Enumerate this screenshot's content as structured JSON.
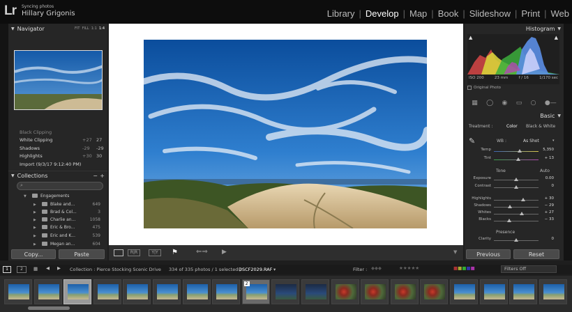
{
  "header": {
    "logo": "Lr",
    "sync_status": "Syncing photos",
    "user_name": "Hillary Grigonis",
    "modules": [
      "Library",
      "Develop",
      "Map",
      "Book",
      "Slideshow",
      "Print",
      "Web"
    ],
    "active_module": "Develop"
  },
  "navigator": {
    "title": "Navigator",
    "zoom_options": [
      "FIT",
      "FILL",
      "1:1",
      "1:4"
    ]
  },
  "history": {
    "rows": [
      {
        "label": "Black Clipping",
        "v1": "",
        "v2": ""
      },
      {
        "label": "White Clipping",
        "v1": "+27",
        "v2": "27"
      },
      {
        "label": "Shadows",
        "v1": "-29",
        "v2": "-29"
      },
      {
        "label": "Highlights",
        "v1": "+30",
        "v2": "30"
      },
      {
        "label": "Import (9/3/17 9:12:40 PM)",
        "v1": "",
        "v2": ""
      }
    ]
  },
  "collections": {
    "title": "Collections",
    "add_icon": "+",
    "minus_icon": "−",
    "items": [
      {
        "name": "Engagements",
        "count": "",
        "level": 0
      },
      {
        "name": "Blake and...",
        "count": "649",
        "level": 1
      },
      {
        "name": "Brad & Col...",
        "count": "3",
        "level": 1
      },
      {
        "name": "Charlie an...",
        "count": "1058",
        "level": 1
      },
      {
        "name": "Eric & Bro...",
        "count": "475",
        "level": 1
      },
      {
        "name": "Eric and K...",
        "count": "539",
        "level": 1
      },
      {
        "name": "Megan an...",
        "count": "604",
        "level": 1
      }
    ]
  },
  "left_buttons": {
    "copy": "Copy...",
    "paste": "Paste"
  },
  "histogram": {
    "title": "Histogram",
    "iso": "ISO 200",
    "focal": "23 mm",
    "aperture": "f / 16",
    "shutter": "1/170 sec",
    "original_label": "Original Photo"
  },
  "basic": {
    "title": "Basic",
    "treatment_label": "Treatment :",
    "color": "Color",
    "bw": "Black & White",
    "wb_label": "WB :",
    "wb_value": "As Shot",
    "tone_label": "Tone",
    "auto_label": "Auto",
    "presence_label": "Presence",
    "sliders": [
      {
        "label": "Temp",
        "value": "5,350",
        "pos": 0.58
      },
      {
        "label": "Tint",
        "value": "+ 13",
        "pos": 0.55
      },
      {
        "label": "Exposure",
        "value": "0.00",
        "pos": 0.5
      },
      {
        "label": "Contrast",
        "value": "0",
        "pos": 0.5
      },
      {
        "label": "Highlights",
        "value": "+ 30",
        "pos": 0.65
      },
      {
        "label": "Shadows",
        "value": "− 29",
        "pos": 0.36
      },
      {
        "label": "Whites",
        "value": "+ 27",
        "pos": 0.63
      },
      {
        "label": "Blacks",
        "value": "− 33",
        "pos": 0.34
      },
      {
        "label": "Clarity",
        "value": "0",
        "pos": 0.5
      }
    ]
  },
  "right_buttons": {
    "previous": "Previous",
    "reset": "Reset"
  },
  "filmstrip": {
    "page1": "1",
    "page2": "2",
    "source": "Collection : Pierce Stocking Scenic Drive",
    "count_text": "334 of 335 photos / 1 selected /",
    "filename": "DSCF2029.RAF",
    "filter_label": "Filter :",
    "filters_off": "Filters Off",
    "selected_badge": "2"
  },
  "colors": {
    "accent": "#ffffff",
    "panel": "#262626",
    "background": "#1e1e1e"
  }
}
